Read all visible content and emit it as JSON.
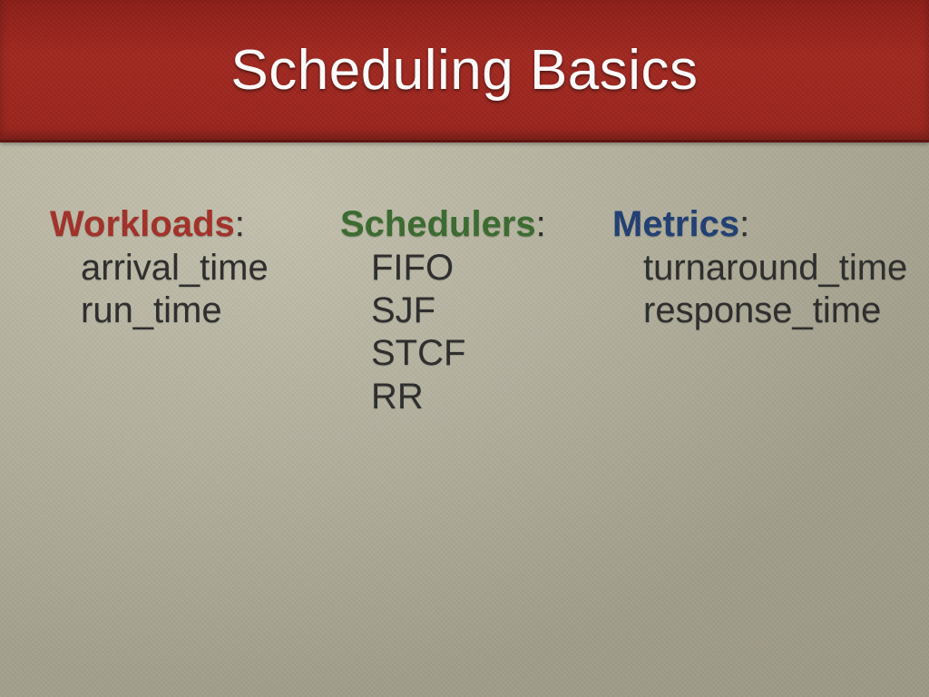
{
  "title": "Scheduling Basics",
  "columns": {
    "workloads": {
      "heading": "Workloads",
      "colon": ":",
      "items": [
        "arrival_time",
        "run_time"
      ]
    },
    "schedulers": {
      "heading": "Schedulers",
      "colon": ":",
      "items": [
        "FIFO",
        "SJF",
        "STCF",
        "RR"
      ]
    },
    "metrics": {
      "heading": "Metrics",
      "colon": ":",
      "items": [
        "turnaround_time",
        "response_time"
      ]
    }
  }
}
